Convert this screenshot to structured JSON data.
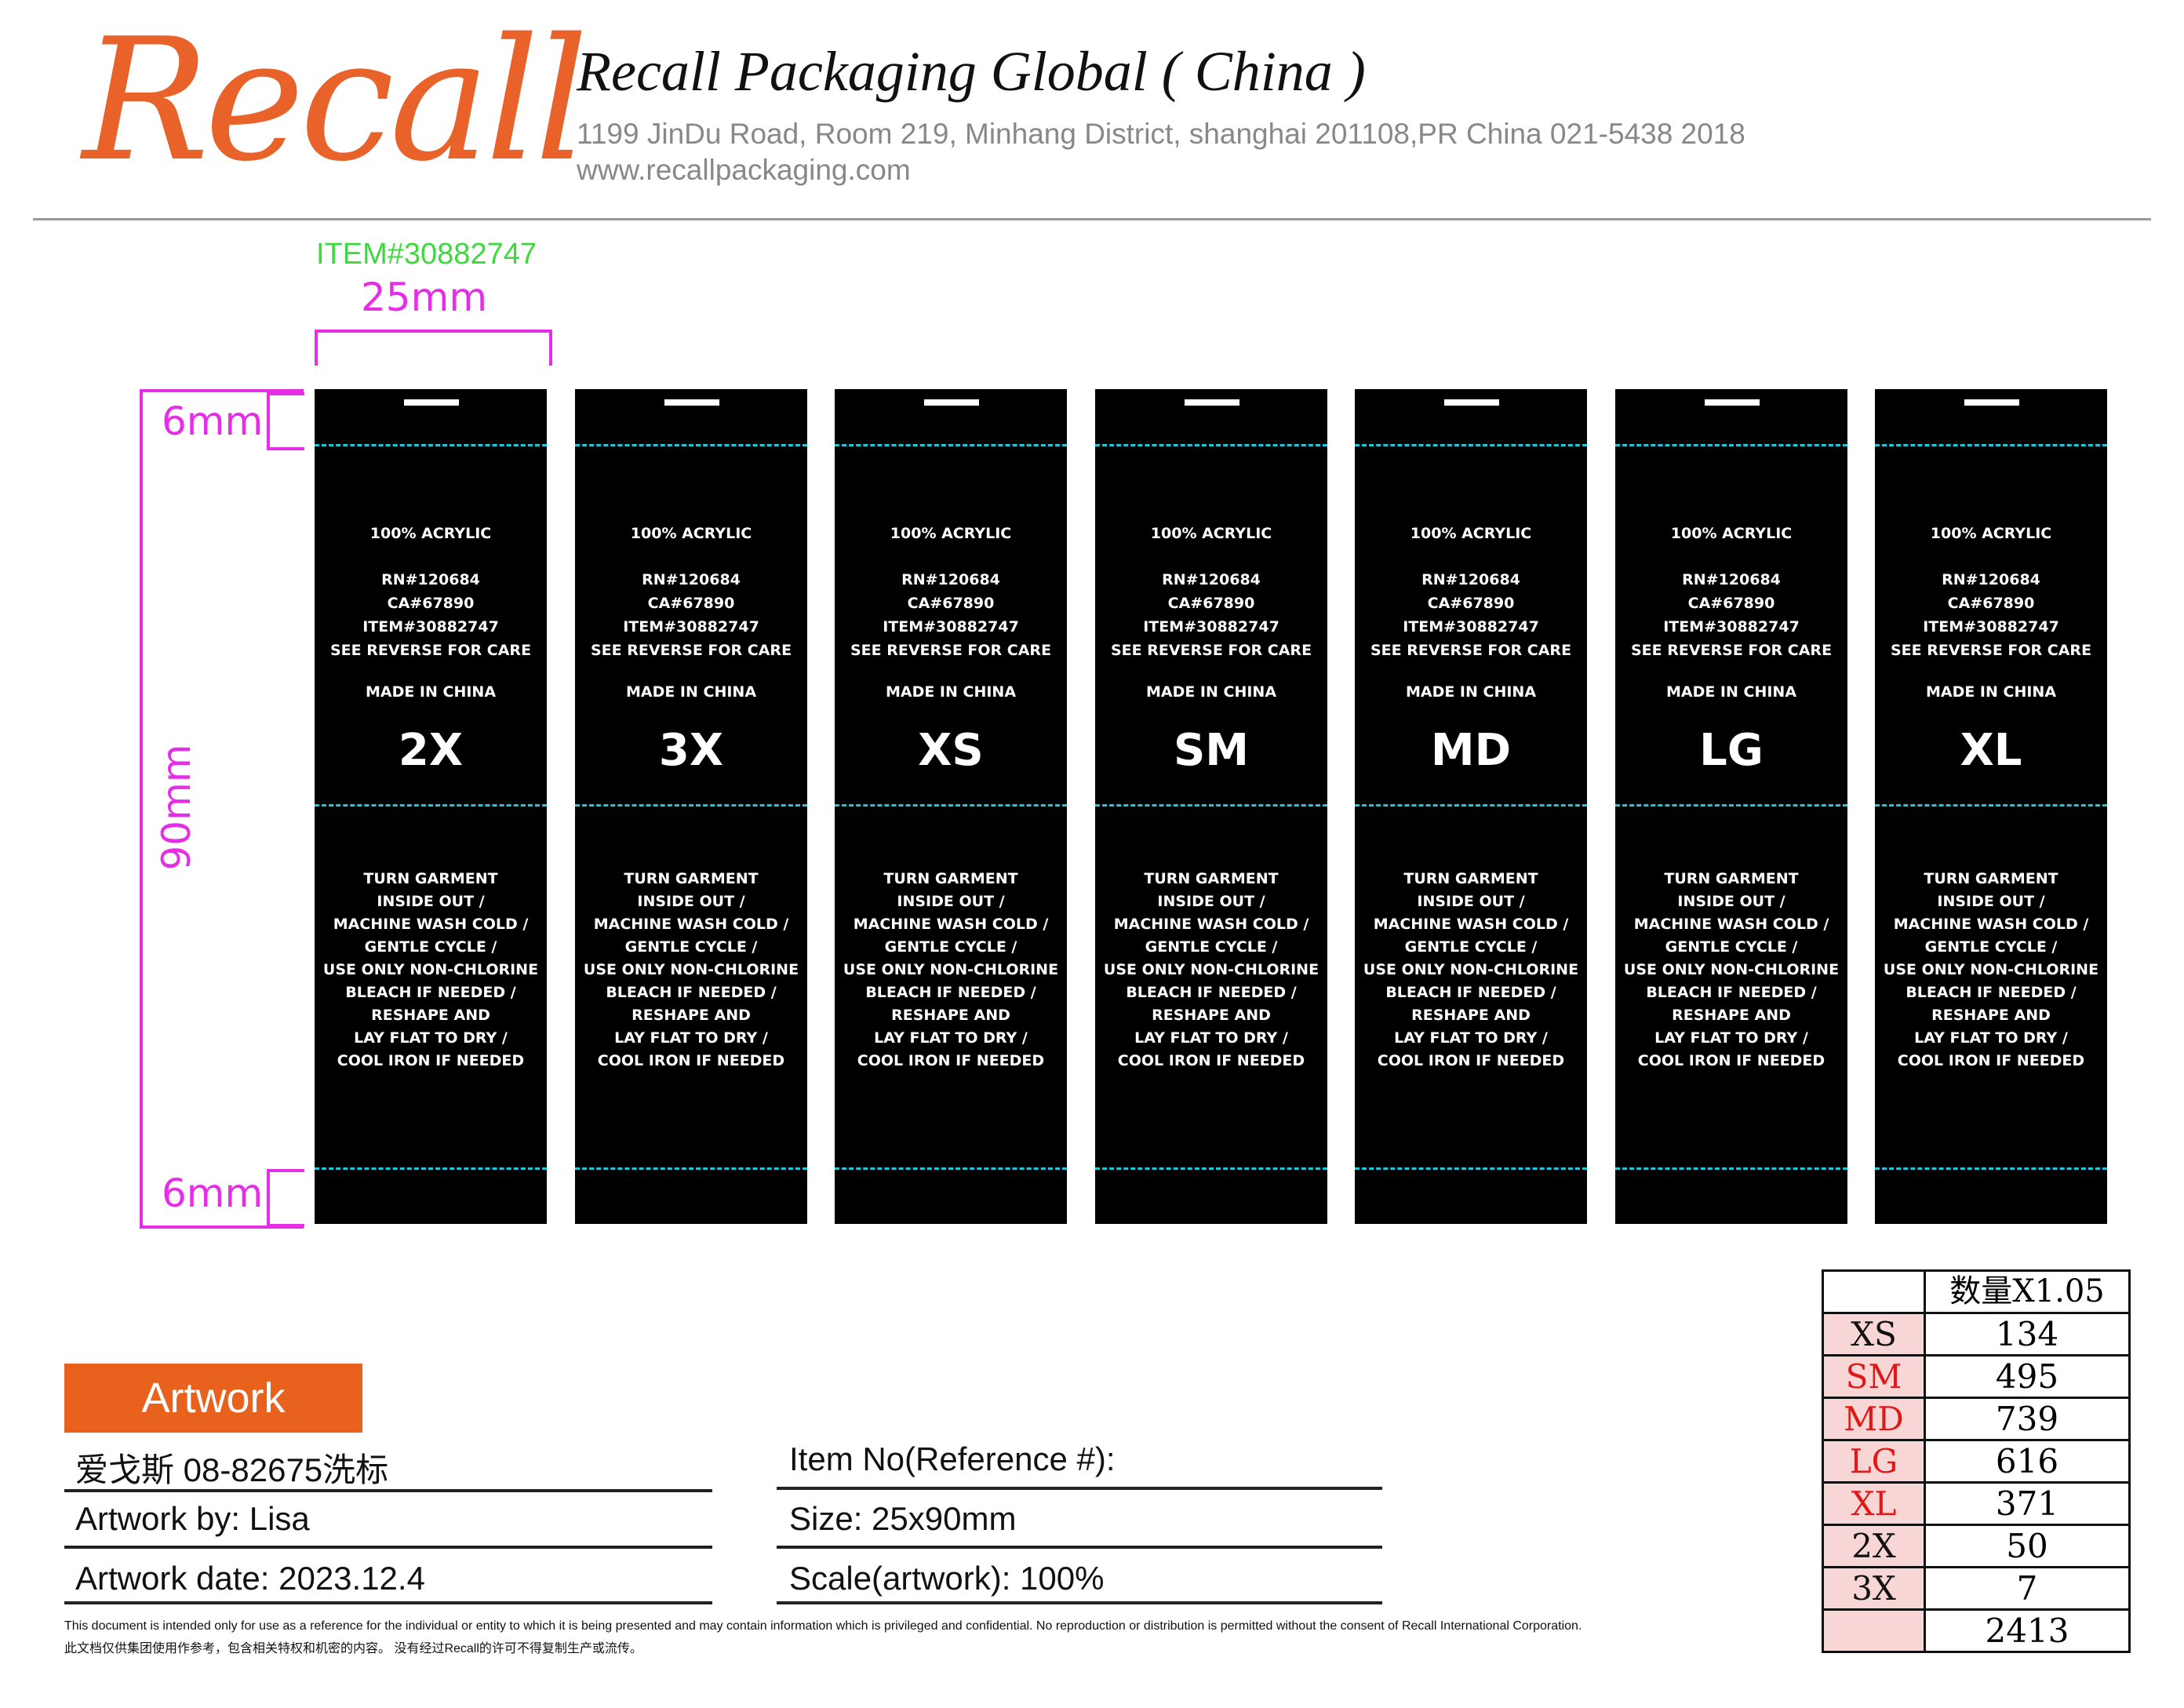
{
  "header": {
    "logo_text": "Recall",
    "company_name": "Recall Packaging Global ( China )",
    "address": "1199 JinDu Road, Room 219, Minhang District, shanghai 201108,PR China   021-5438 2018",
    "website": "www.recallpackaging.com"
  },
  "dimensions": {
    "item_code": "ITEM#30882747",
    "width": "25mm",
    "height": "90mm",
    "top_gap": "6mm",
    "bottom_gap": "6mm"
  },
  "labels": {
    "fiber": "100% ACRYLIC",
    "rn": "RN#120684",
    "ca": "CA#67890",
    "item": "ITEM#30882747",
    "see_reverse": "SEE REVERSE FOR CARE",
    "origin": "MADE IN CHINA",
    "care_lines": [
      "TURN GARMENT",
      "INSIDE OUT /",
      "MACHINE WASH COLD /",
      "GENTLE CYCLE /",
      "USE ONLY NON-CHLORINE",
      "BLEACH IF NEEDED /",
      "RESHAPE AND",
      "LAY FLAT TO DRY /",
      "COOL IRON IF NEEDED"
    ],
    "sizes": [
      "2X",
      "3X",
      "XS",
      "SM",
      "MD",
      "LG",
      "XL"
    ]
  },
  "artwork": {
    "badge": "Artwork",
    "job_name": "爱戈斯 08-82675洗标",
    "artwork_by": "Artwork by:  Lisa",
    "artwork_date": "Artwork date: 2023.12.4",
    "item_no": "Item No(Reference #):",
    "size": "Size: 25x90mm",
    "scale": "Scale(artwork): 100%"
  },
  "disclaimer": {
    "en": "This document is intended only for use as a reference for the individual or entity to which it is being presented and may contain information which is privileged and confidential. No reproduction or distribution is permitted without the consent of Recall International Corporation.",
    "cn": "此文档仅供集团使用作参考，包含相关特权和机密的内容。  没有经过Recall的许可不得复制生产或流传。"
  },
  "quantity_table": {
    "header": "数量X1.05",
    "rows": [
      {
        "size": "XS",
        "qty": "134"
      },
      {
        "size": "SM",
        "qty": "495"
      },
      {
        "size": "MD",
        "qty": "739"
      },
      {
        "size": "LG",
        "qty": "616"
      },
      {
        "size": "XL",
        "qty": "371"
      },
      {
        "size": "2X",
        "qty": "50"
      },
      {
        "size": "3X",
        "qty": "7"
      }
    ],
    "total": "2413"
  },
  "colors": {
    "brand_orange": "#e8622a",
    "dimension_magenta": "#e62ee6",
    "item_green": "#3dd93d",
    "fold_line_cyan": "#1fc8d8",
    "size_red": "#e01818"
  }
}
